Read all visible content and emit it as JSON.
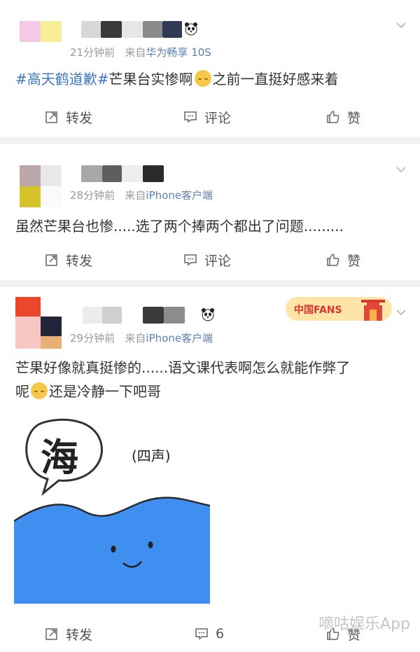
{
  "posts": [
    {
      "time": "21分钟前",
      "source_label": "来自",
      "source": "华为畅享 10S",
      "topic": "#高天鹤道歉#",
      "text_a": "芒果台实惨啊",
      "text_b": "之前一直挺好感来着",
      "actions": {
        "repost": "转发",
        "comment": "评论",
        "like": "赞"
      }
    },
    {
      "time": "28分钟前",
      "source_label": "来自",
      "source": "iPhone客户端",
      "text": "虽然芒果台也惨.....选了两个捧两个都出了问题.........",
      "actions": {
        "repost": "转发",
        "comment": "评论",
        "like": "赞"
      }
    },
    {
      "time": "29分钟前",
      "source_label": "来自",
      "source": "iPhone客户端",
      "badge": "中国FANS",
      "line1": "芒果好像就真挺惨的......语文课代表啊怎么就能作弊了",
      "line2_a": "呢",
      "line2_b": "还是冷静一下吧哥",
      "image": {
        "char": "海",
        "note": "(四声)"
      },
      "actions": {
        "repost": "转发",
        "comment": "6",
        "like": "赞"
      }
    }
  ],
  "watermark": "嘀咕娱乐App",
  "icons": [
    "chevron-down-icon",
    "repost-icon",
    "comment-icon",
    "like-icon",
    "panda-icon"
  ],
  "colors": {
    "topic": "#3b78c5",
    "meta": "#9a9a9a",
    "background": "#f2f2f2"
  }
}
